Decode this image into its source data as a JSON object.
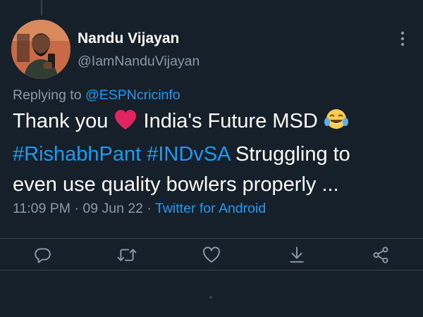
{
  "author": {
    "display_name": "Nandu Vijayan",
    "handle": "@IamNanduVijayan"
  },
  "reply": {
    "prefix": "Replying to ",
    "mention": "@ESPNcricinfo"
  },
  "tweet": {
    "part1": "Thank you ",
    "part2": " India's Future MSD ",
    "hashtag1": "#RishabhPant",
    "hashtag2": "#INDvSA",
    "part3": " Struggling to",
    "line3": "even use quality bowlers properly ...",
    "emojis": [
      "red-heart",
      "face-with-tears-of-joy"
    ]
  },
  "meta": {
    "time": "11:09 PM",
    "sep1": " · ",
    "date": "09 Jun 22",
    "sep2": " · ",
    "source": "Twitter for Android"
  },
  "actions": [
    {
      "icon": "reply-icon"
    },
    {
      "icon": "retweet-icon"
    },
    {
      "icon": "like-icon"
    },
    {
      "icon": "bookmark-icon"
    },
    {
      "icon": "share-icon"
    }
  ],
  "colors": {
    "background": "#15202b",
    "text": "#ffffff",
    "secondary": "#8b98a5",
    "accent": "#1d9bf0",
    "heart": "#e0245e"
  }
}
